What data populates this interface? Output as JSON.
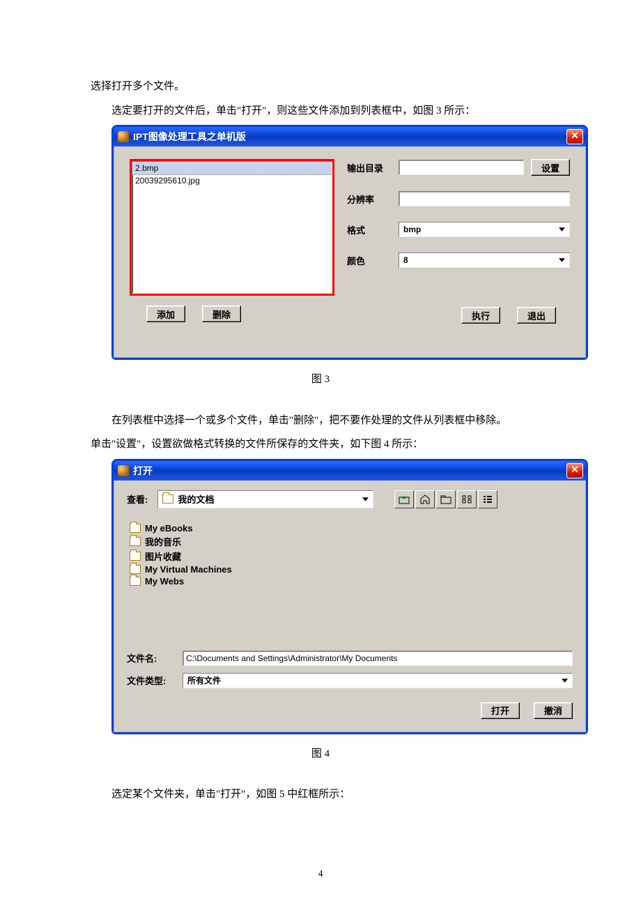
{
  "paragraphs": {
    "p1": "选择打开多个文件。",
    "p2": "选定要打开的文件后，单击\"打开\"，则这些文件添加到列表框中，如图 3 所示：",
    "cap3": "图 3",
    "p3": "在列表框中选择一个或多个文件，单击\"删除\"，把不要作处理的文件从列表框中移除。",
    "p4": "单击\"设置\"，设置欲做格式转换的文件所保存的文件夹，如下图 4 所示：",
    "cap4": "图 4",
    "p5": "选定某个文件夹，单击\"打开\"，如图 5 中红框所示：",
    "page_num": "4"
  },
  "fig3": {
    "title": "IPT图像处理工具之单机版",
    "list": [
      {
        "name": "2.bmp",
        "selected": true
      },
      {
        "name": "20039295610.jpg",
        "selected": false
      }
    ],
    "labels": {
      "output_dir": "输出目录",
      "resolution": "分辨率",
      "format": "格式",
      "color": "颜色"
    },
    "values": {
      "output_dir": "",
      "resolution": "",
      "format": "bmp",
      "color": "8"
    },
    "buttons": {
      "settings": "设置",
      "add": "添加",
      "delete": "删除",
      "run": "执行",
      "exit": "退出"
    }
  },
  "fig4": {
    "title": "打开",
    "labels": {
      "lookin": "查看:",
      "filename": "文件名:",
      "filetype": "文件类型:"
    },
    "lookin_value": "我的文档",
    "files": [
      "My eBooks",
      "我的音乐",
      "图片收藏",
      "My Virtual Machines",
      "My Webs"
    ],
    "filename_value": "C:\\Documents and Settings\\Administrator\\My Documents",
    "filetype_value": "所有文件",
    "buttons": {
      "open": "打开",
      "cancel": "撤消"
    }
  }
}
